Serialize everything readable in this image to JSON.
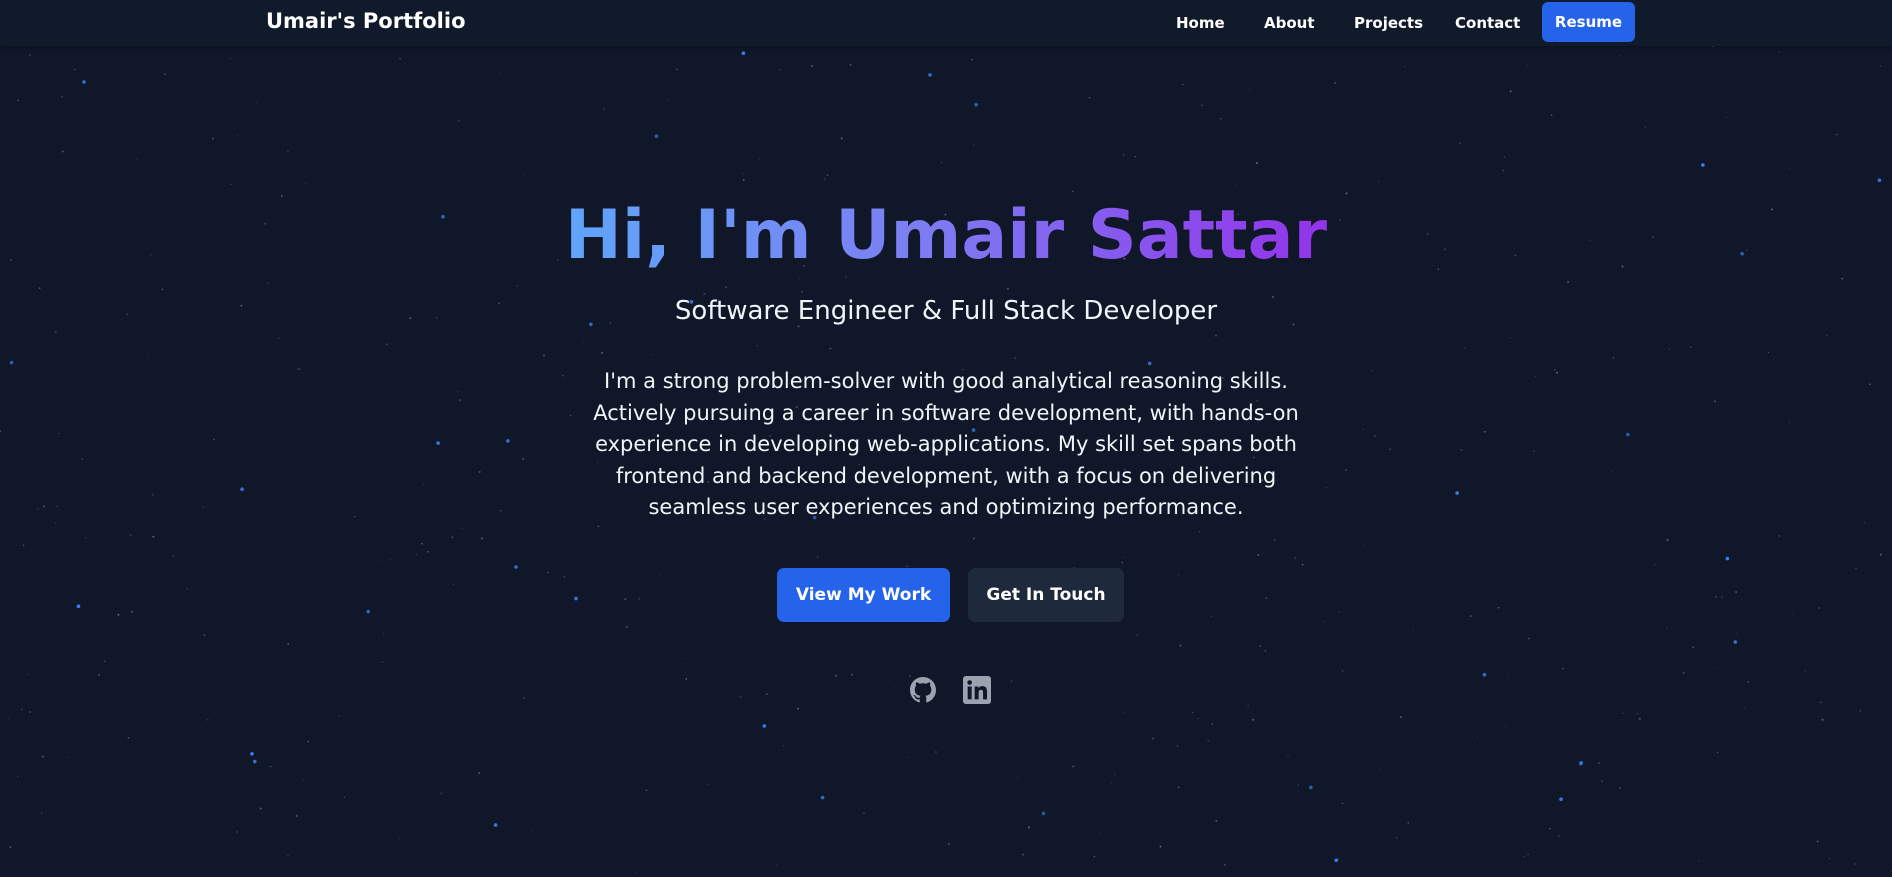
{
  "navbar": {
    "brand": "Umair's Portfolio",
    "links": [
      {
        "label": "Home"
      },
      {
        "label": "About"
      },
      {
        "label": "Projects"
      },
      {
        "label": "Contact"
      }
    ],
    "resume_label": "Resume"
  },
  "hero": {
    "title": "Hi, I'm Umair Sattar",
    "subtitle": "Software Engineer & Full Stack Developer",
    "description": "I'm a strong problem-solver with good analytical reasoning skills. Actively pursuing a career in software development, with hands-on experience in developing web-applications. My skill set spans both frontend and backend development, with a focus on delivering seamless user experiences and optimizing performance.",
    "primary_button": "View My Work",
    "secondary_button": "Get In Touch"
  },
  "social": [
    {
      "icon": "github-icon"
    },
    {
      "icon": "linkedin-icon"
    }
  ],
  "colors": {
    "background": "#0f1729",
    "navbar_bg": "#111a2b",
    "accent": "#2563eb",
    "secondary_button": "#1e293b",
    "gradient_start": "#60a5fa",
    "gradient_end": "#9333ea",
    "icon": "#9ca3af",
    "star": "#3b82f6"
  }
}
